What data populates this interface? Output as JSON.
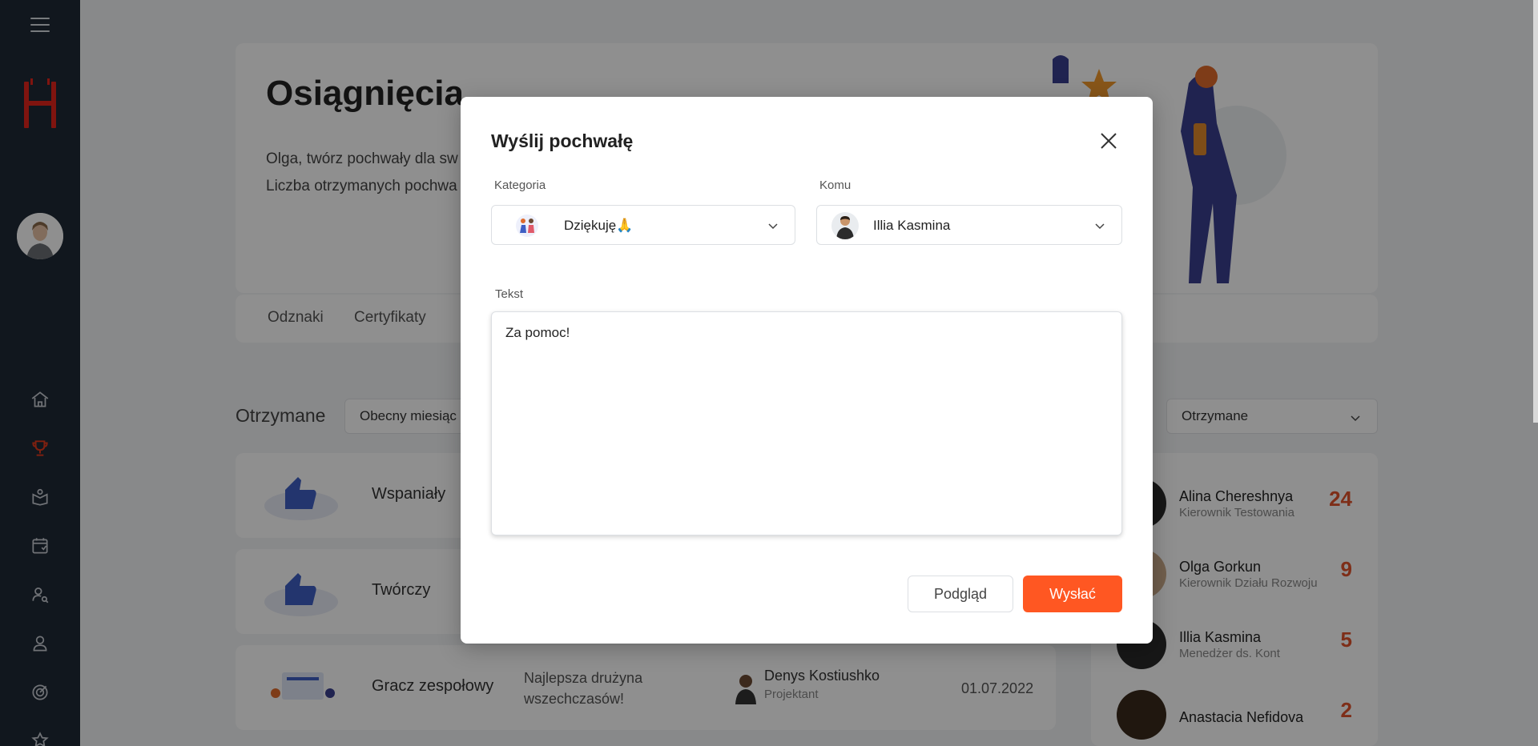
{
  "sidebar": {
    "nav": [
      "home-icon",
      "trophy-icon",
      "education-icon",
      "calendar-icon",
      "user-search-icon",
      "profile-icon",
      "target-icon",
      "network-icon"
    ]
  },
  "page": {
    "title": "Osiągnięcia",
    "text_line1": "Olga, twórz pochwały dla sw",
    "text_line2": "Liczba otrzymanych pochwa",
    "tabs": [
      "Odznaki",
      "Certyfikaty"
    ],
    "filter_label": "Otrzymane",
    "filter_period": "Obecny miesiąc",
    "filter_right": "Otrzymane",
    "rows": [
      {
        "name": "Wspaniały",
        "text": "",
        "person": "",
        "role": "",
        "date": ""
      },
      {
        "name": "Twórczy",
        "text": "",
        "person": "",
        "role": "",
        "date": ""
      },
      {
        "name": "Gracz zespołowy",
        "text": "Najlepsza drużyna wszechczasów!",
        "person": "Denys Kostiushko",
        "role": "Projektant",
        "date": "01.07.2022"
      }
    ],
    "ranking": [
      {
        "name": "Alina Chereshnya",
        "role": "Kierownik Testowania",
        "score": "24"
      },
      {
        "name": "Olga Gorkun",
        "role": "Kierownik Działu Rozwoju",
        "score": "9"
      },
      {
        "name": "Illia Kasmina",
        "role": "Menedżer ds. Kont",
        "score": "5"
      },
      {
        "name": "Anastacia Nefidova",
        "role": "",
        "score": "2"
      }
    ]
  },
  "modal": {
    "title": "Wyślij pochwałę",
    "category_label": "Kategoria",
    "category_value": "Dziękuję🙏",
    "recipient_label": "Komu",
    "recipient_value": "Illia Kasmina",
    "text_label": "Tekst",
    "text_value": "Za pomoc!",
    "preview_button": "Podgląd",
    "send_button": "Wysłać"
  },
  "colors": {
    "accent": "#ff5722",
    "sidebar": "#1f2a37",
    "score": "#e0522c"
  }
}
